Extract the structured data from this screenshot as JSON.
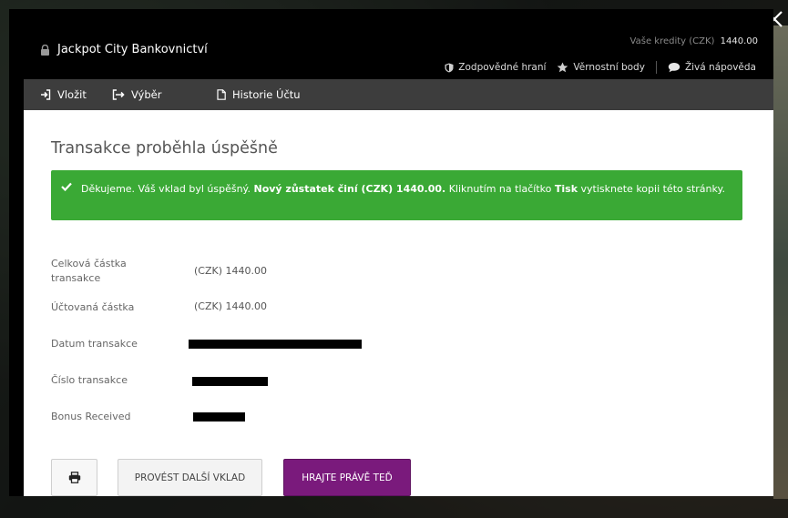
{
  "brand": {
    "title": "Jackpot City Bankovnictví"
  },
  "credits": {
    "label": "Vaše kredity (CZK)",
    "amount": "1440.00"
  },
  "header_links": [
    {
      "label": "Zodpovědné hraní",
      "icon": "shield-icon"
    },
    {
      "label": "Věrnostní body",
      "icon": "star-icon"
    },
    {
      "label": "Živá nápověda",
      "icon": "chat-bubble-icon"
    }
  ],
  "tabs": [
    {
      "label": "Vložit",
      "icon": "deposit-icon"
    },
    {
      "label": "Výběr",
      "icon": "withdraw-icon"
    },
    {
      "label": "Historie Účtu",
      "icon": "document-icon"
    }
  ],
  "page": {
    "title": "Transakce proběhla úspěšně"
  },
  "alert": {
    "part1": "Děkujeme.  Váš vklad byl úspěšný.",
    "bold1": "Nový zůstatek činí (CZK) 1440.00.",
    "part2": "Kliknutím na tlačítko",
    "bold2": "Tisk",
    "part3": "vytisknete kopii této stránky.",
    "color": "#3aa935"
  },
  "details": [
    {
      "label": "Celková částka transakce",
      "value": "(CZK) 1440.00"
    },
    {
      "label": "Účtovaná částka",
      "value": "(CZK) 1440.00"
    },
    {
      "label": "Datum transakce",
      "value": ""
    },
    {
      "label": "Číslo transakce",
      "value": ""
    },
    {
      "label": "Bonus Received",
      "value": ""
    }
  ],
  "buttons": {
    "deposit_again": "PROVÉST DALŠÍ VKLAD",
    "play_now": "HRAJTE PRÁVĚ TEĎ",
    "play_color": "#7a1a7c"
  }
}
